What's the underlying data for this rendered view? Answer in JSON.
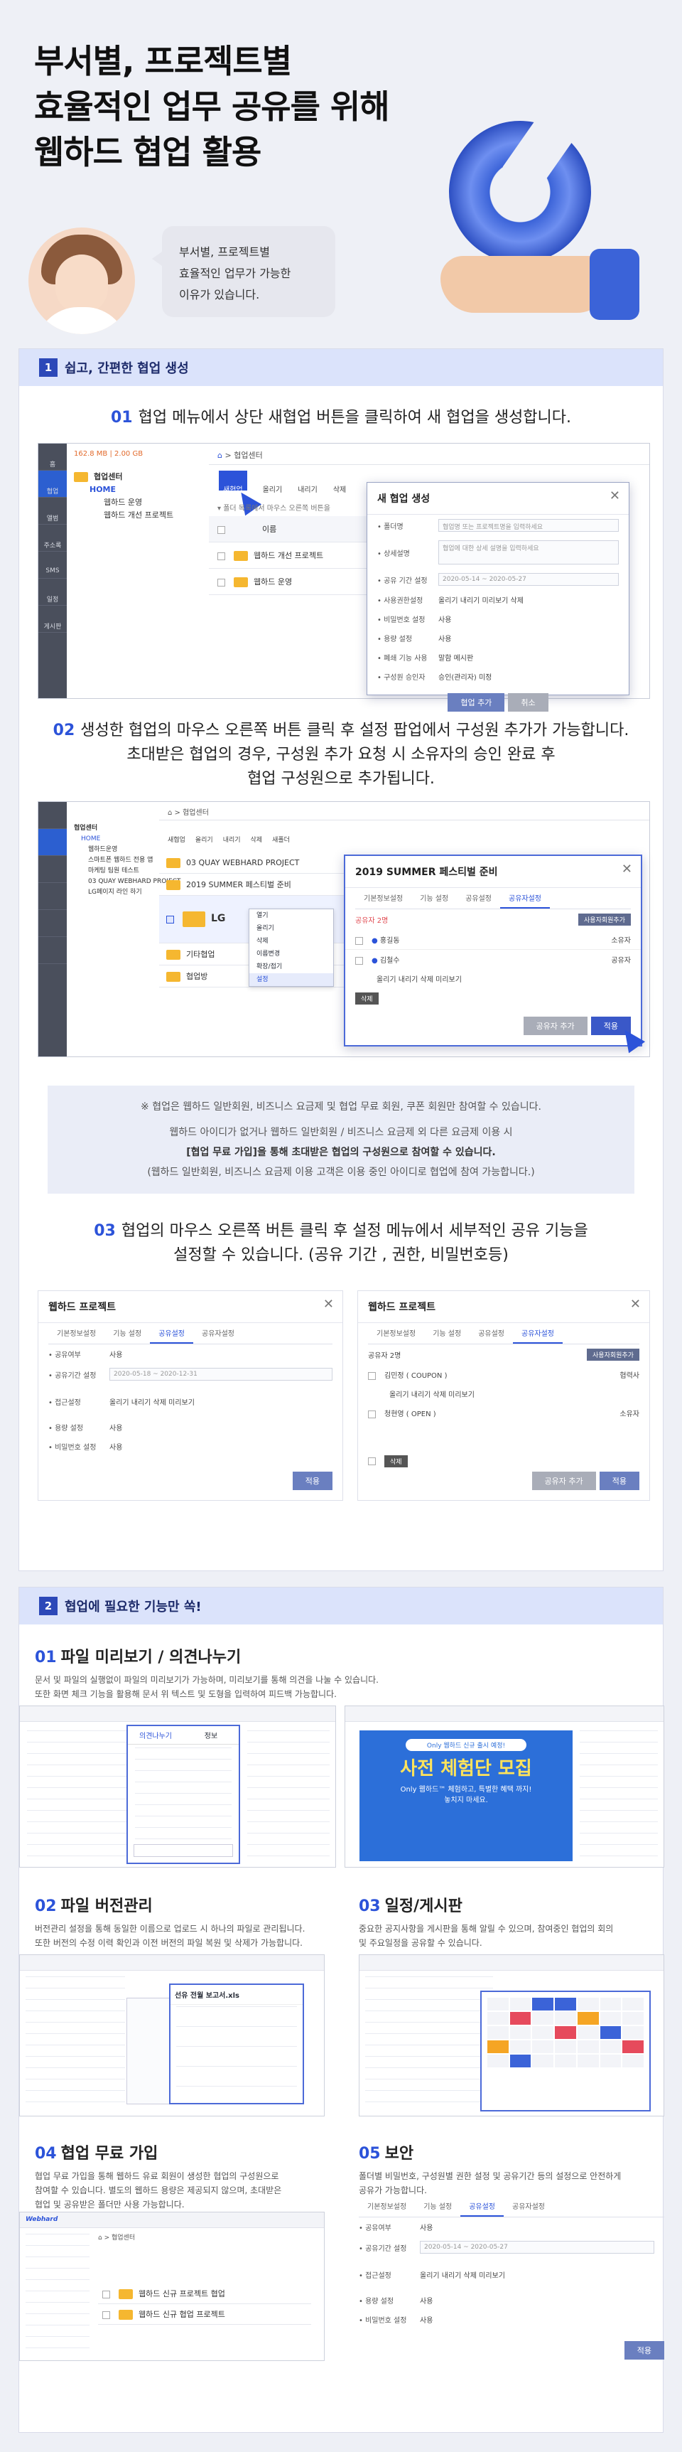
{
  "hero": {
    "title_lines": [
      "부서별, 프로젝트별",
      "효율적인 업무 공유를 위해",
      "웹하드 협업 활용"
    ],
    "bubble_lines": [
      "부서별, 프로젝트별",
      "효율적인 업무가 가능한",
      "이유가 있습니다."
    ]
  },
  "section1": {
    "badge": "1",
    "title": "쉽고, 간편한 협업 생성",
    "step1": {
      "no": "01",
      "text": "협업 메뉴에서 상단 새협업 버튼을 클릭하여 새 협업을 생성합니다.",
      "sidebar": [
        "홈",
        "협업",
        "앨범",
        "주소록",
        "SMS",
        "일정",
        "게시판"
      ],
      "capacity": "162.8 MB | 2.00 GB",
      "tree_title": "협업센터",
      "tree_items": [
        "HOME",
        "웹하드 운영",
        "웹하드 개선 프로젝트"
      ],
      "path": "협업센터",
      "toolbar": [
        "새협업",
        "올리기",
        "내리기",
        "삭제"
      ],
      "hint": "폴더 목록에서 마우스 오른쪽 버튼을",
      "col_name": "이름",
      "rows": [
        "웹하드 개선 프로젝트",
        "웹하드 운영"
      ],
      "modal": {
        "title": "새 협업 생성",
        "fields": [
          {
            "label": "• 폴더명",
            "value": "협업명 또는 프로젝트명을 입력하세요"
          },
          {
            "label": "• 상세설명",
            "value": "협업에 대한 상세 설명을 입력하세요"
          },
          {
            "label": "• 공유 기간 설정",
            "value": "2020-05-14  ~  2020-05-27"
          },
          {
            "label": "• 사용권한설정",
            "value": "올리기  내리기  미리보기  삭제"
          },
          {
            "label": "• 비밀번호 설정",
            "value": "사용"
          },
          {
            "label": "• 용량 설정",
            "value": "사용"
          },
          {
            "label": "• 폐쇄 기능 사용",
            "value": "말함  메시판"
          },
          {
            "label": "• 구성원 승인자",
            "value": "승인(관리자)  미정"
          }
        ],
        "ok": "협업 추가",
        "cancel": "취소"
      }
    },
    "step2": {
      "lines": [
        {
          "no": "02",
          "text": "생성한 협업의 마우스 오른쪽 버튼 클릭 후 설정 팝업에서 구성원 추가가 가능합니다."
        },
        {
          "no": "",
          "text": "초대받은 협업의 경우, 구성원 추가 요청 시 소유자의 승인 완료 후"
        },
        {
          "no": "",
          "text": "협업 구성원으로 추가됩니다."
        }
      ],
      "tree_items": [
        "협업센터",
        "HOME",
        "웹하드운영",
        "스마트폰 웹하드 전용 앱",
        "마케팅 팀원 테스트",
        "03 QUAY WEBHARD PROJECT",
        "LG페이지 라인 하기"
      ],
      "path": "협업센터",
      "toolbar": [
        "새협업",
        "올리기",
        "내리기",
        "삭제",
        "새폴더"
      ],
      "list": [
        "03 QUAY WEBHARD PROJECT",
        "2019 SUMMER 페스티벌 준비",
        "LG",
        "기타협업",
        "협업방"
      ],
      "context_menu": [
        "열기",
        "올리기",
        "삭제",
        "이름변경",
        "확장/접기",
        "설정"
      ],
      "modal": {
        "title": "2019 SUMMER 페스티벌 준비",
        "tabs": [
          "기본정보설정",
          "기능 설정",
          "공유설정",
          "공유자설정"
        ],
        "count_label": "공유자 2명",
        "add_btn": "사용자회원추가",
        "members": [
          {
            "name": "홍길동",
            "role": "소유자"
          },
          {
            "name": "김철수",
            "role": "공유자"
          }
        ],
        "perms": "올리기  내리기  삭제  미리보기",
        "delete_btn": "삭제",
        "ok": "공유자 추가",
        "apply": "적용"
      }
    },
    "notice": [
      "※ 협업은 웹하드 일반회원, 비즈니스 요금제 및 협업 무료 회원, 쿠폰 회원만 참여할 수 있습니다.",
      "웹하드 아이디가 없거나 웹하드 일반회원 / 비즈니스 요금제 외 다른 요금제 이용 시",
      "[협업 무료 가입]을 통해 초대받은 협업의 구성원으로 참여할 수 있습니다.",
      "(웹하드 일반회원, 비즈니스 요금제 이용 고객은 이용 중인 아이디로 협업에 참여 가능합니다.)"
    ],
    "step3": {
      "no": "03",
      "line1": "협업의 마우스 오른쪽 버튼 클릭 후 설정 메뉴에서 세부적인 공유 기능을",
      "line2": "설정할 수 있습니다. (공유 기간 , 권한, 비밀번호등)",
      "left": {
        "title": "웹하드 프로젝트",
        "tabs": [
          "기본정보설정",
          "기능 설정",
          "공유설정",
          "공유자설정"
        ],
        "rows": [
          {
            "label": "• 공유여부",
            "value": "사용"
          },
          {
            "label": "• 공유기간 설정",
            "value": "2020-05-18  ~  2020-12-31"
          },
          {
            "label": "• 접근설정",
            "value": "올리기  내리기  삭제  미리보기"
          },
          {
            "label": "• 용량 설정",
            "value": "사용"
          },
          {
            "label": "• 비밀번호 설정",
            "value": "사용"
          }
        ],
        "apply": "적용"
      },
      "right": {
        "title": "웹하드 프로젝트",
        "tabs": [
          "기본정보설정",
          "기능 설정",
          "공유설정",
          "공유자설정"
        ],
        "count_label": "공유자 2명",
        "add_btn": "사용자회원추가",
        "members": [
          {
            "name": "김민정 ( COUPON )",
            "role": "협력사"
          },
          {
            "name": "청현영 ( OPEN )",
            "role": "소유자"
          }
        ],
        "perms": "올리기  내리기  삭제  미리보기",
        "delete_btn": "삭제",
        "ok": "공유자 추가",
        "apply": "적용"
      }
    }
  },
  "section2": {
    "badge": "2",
    "title": "협업에 필요한 기능만 쏙!",
    "f1": {
      "no": "01",
      "title": "파일 미리보기 / 의견나누기",
      "desc": [
        "문서 및 파일의 실행없이 파일의 미리보기가 가능하며, 미리보기를 통해 의견을 나눌 수 있습니다.",
        "또한 화면 체크 기능을 활용해 문서 위 텍스트 및 도형을 입력하여 피드백 가능합니다."
      ],
      "panel_tabs": [
        "의견나누기",
        "정보"
      ],
      "poster_small": "Only 웹하드 신규 출시 예정!",
      "poster_big": "사전 체험단 모집",
      "poster_sub": "Only 웹하드™ 체험하고, 특별한 혜택 까지!",
      "poster_tag": "놓치지 마세요."
    },
    "f2": {
      "no": "02",
      "title": "파일 버전관리",
      "desc": [
        "버전관리 설정을 통해 동일한 이름으로 업로드 시 하나의 파일로 관리됩니다.",
        "또한 버전의 수정 이력 확인과 이전 버전의 파일 복원 및 삭제가 가능합니다."
      ],
      "popup_title": "선유 전월 보고서.xls"
    },
    "f3": {
      "no": "03",
      "title": "일정/게시판",
      "desc": [
        "중요한 공지사항을 게시판을 통해 알릴 수 있으며, 참여중인 협업의 회의",
        "및 주요일정을 공유할 수 있습니다."
      ]
    },
    "f4": {
      "no": "04",
      "title": "협업 무료 가입",
      "desc": [
        "협업 무료 가입을 통해 웹하드 유료 회원이 생성한 협업의 구성원으로",
        "참여할 수 있습니다. 별도의 웹하드 용량은 제공되지 않으며, 초대받은",
        "협업 및 공유받은 폴더만 사용 가능합니다."
      ],
      "brand": "Webhard",
      "path": "협업센터",
      "rows": [
        "웹하드 신규 프로젝트 협업",
        "웹하드 신규 협업 프로젝트"
      ]
    },
    "f5": {
      "no": "05",
      "title": "보안",
      "desc": [
        "폴더별 비밀번호, 구성원별 권한 설정 및 공유기간 등의 설정으로 안전하게",
        "공유가 가능합니다."
      ],
      "tabs": [
        "기본정보설정",
        "기능 설정",
        "공유설정",
        "공유자설정"
      ],
      "rows": [
        {
          "label": "• 공유여부",
          "value": "사용"
        },
        {
          "label": "• 공유기간 설정",
          "value": "2020-05-14  ~  2020-05-27"
        },
        {
          "label": "• 접근설정",
          "value": "올리기  내리기  삭제  미리보기"
        },
        {
          "label": "• 용량 설정",
          "value": "사용"
        },
        {
          "label": "• 비밀번호 설정",
          "value": "사용"
        }
      ],
      "apply": "적용"
    }
  },
  "colors": {
    "accent": "#2c53d9",
    "section_head": "#dbe3fb",
    "folder": "#f5b730"
  }
}
